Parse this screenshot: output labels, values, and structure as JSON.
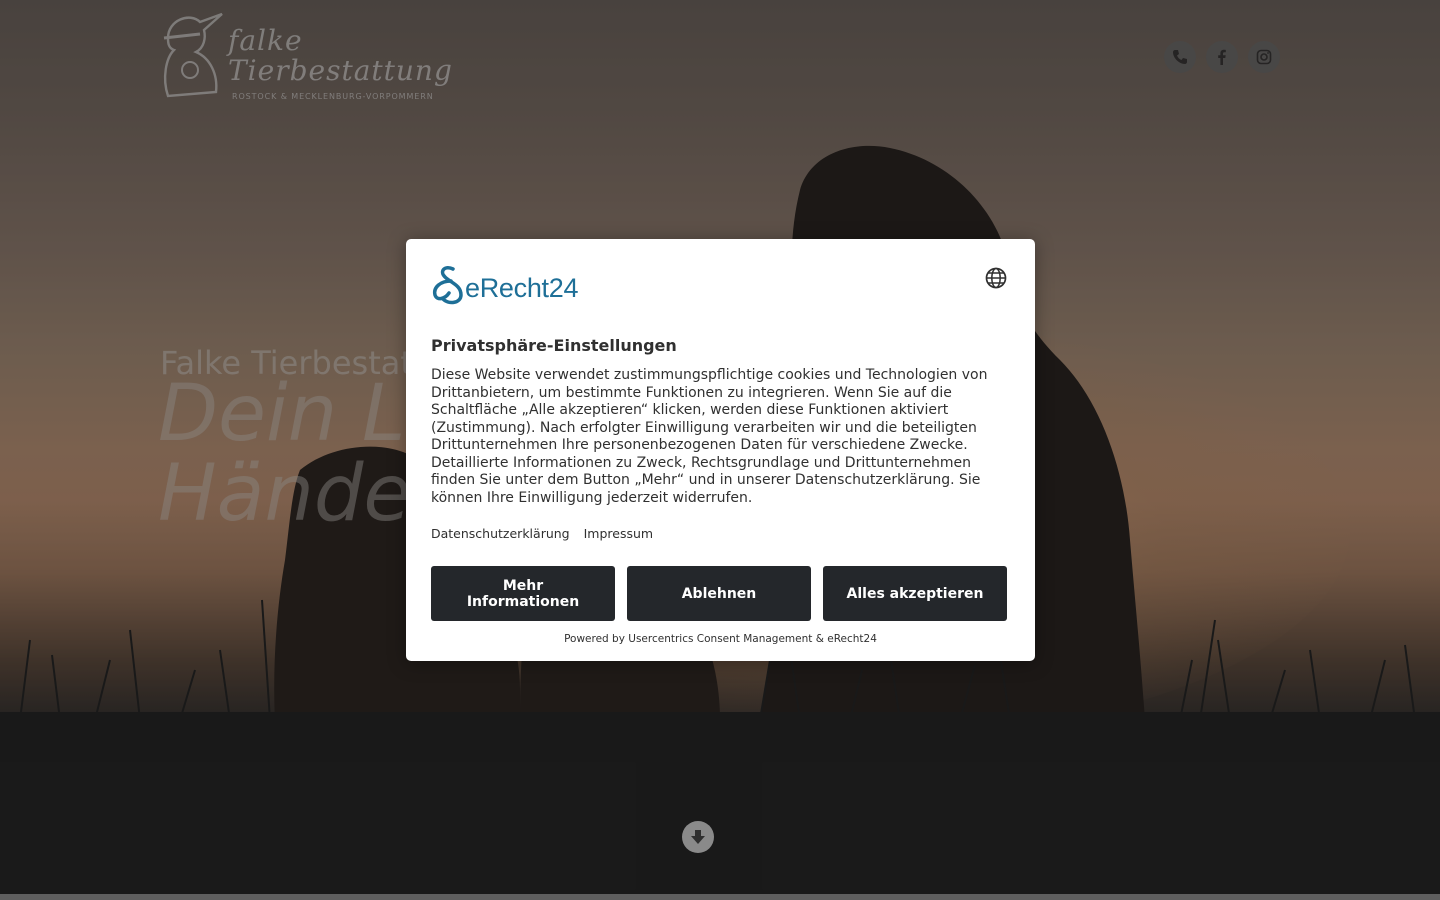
{
  "header": {
    "logo": {
      "line1": "falke",
      "line2": "Tierbestattung",
      "tagline": "ROSTOCK & MECKLENBURG-VORPOMMERN"
    },
    "social_icons": [
      "phone-icon",
      "facebook-icon",
      "instagram-icon"
    ]
  },
  "hero": {
    "subtitle": "Falke Tierbestat",
    "title_line1": "Dein L",
    "title_line2": "Hände"
  },
  "consent": {
    "brand": "eRecht24",
    "title": "Privatsphäre-Einstellungen",
    "body": "Diese Website verwendet zustimmungspflichtige cookies und Technologien von Drittanbietern, um bestimmte Funktionen zu integrieren. Wenn Sie auf die Schaltfläche „Alle akzeptieren“ klicken, werden diese Funktionen aktiviert (Zustimmung). Nach erfolgter Einwilligung verarbeiten wir und die beteiligten Drittunternehmen Ihre personenbezogenen Daten für verschiedene Zwecke. Detaillierte Informationen zu Zweck, Rechtsgrundlage und Drittunternehmen finden Sie unter dem Button „Mehr“ und in unserer Datenschutzerklärung. Sie können Ihre Einwilligung jederzeit widerrufen.",
    "links": {
      "privacy": "Datenschutzerklärung",
      "imprint": "Impressum"
    },
    "buttons": {
      "more": "Mehr Informationen",
      "deny": "Ablehnen",
      "accept": "Alles akzeptieren"
    },
    "powered_by": "Powered by Usercentrics Consent Management & eRecht24"
  },
  "colors": {
    "button_bg": "#24272b",
    "brand_blue": "#1e6f97",
    "text": "#303030"
  }
}
